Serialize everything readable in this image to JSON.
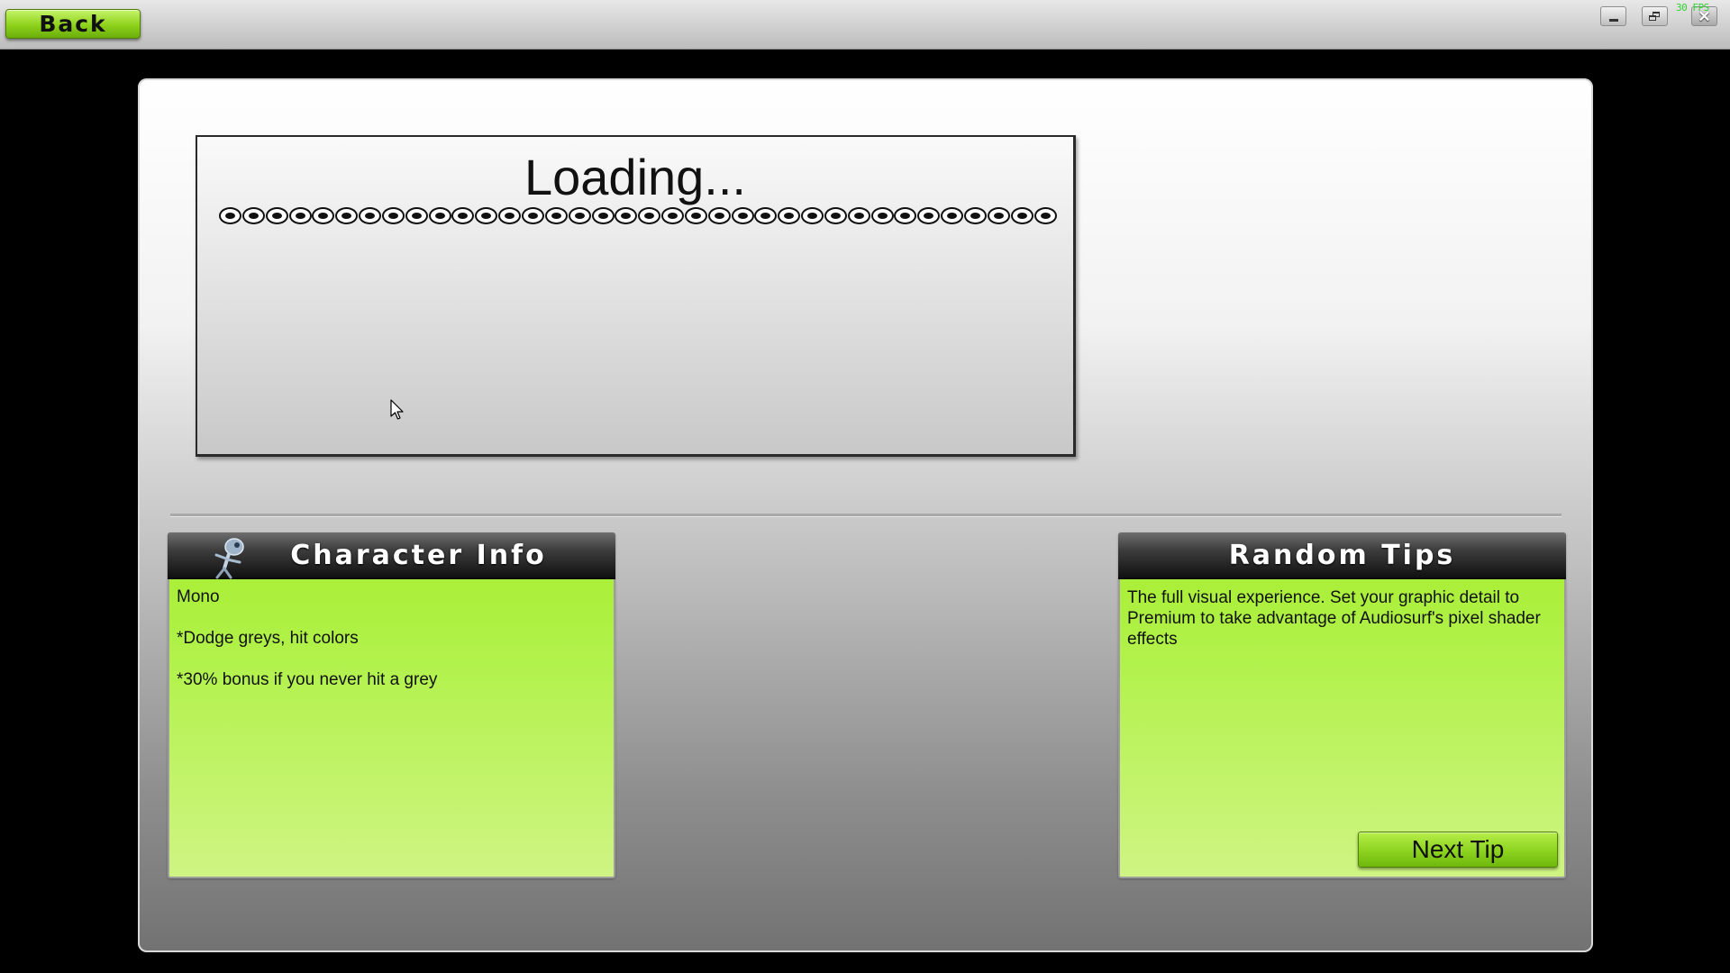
{
  "topbar": {
    "back_label": "Back",
    "fps_readout": "30 FPS"
  },
  "loading": {
    "text": "Loading...",
    "dot_count": 36
  },
  "character_info": {
    "title": "Character Info",
    "lines": [
      "Mono",
      "*Dodge greys, hit colors",
      "*30% bonus if you never hit a grey"
    ]
  },
  "random_tips": {
    "title": "Random Tips",
    "tip": "The full visual experience. Set your graphic detail to Premium to take advantage of Audiosurf's pixel shader effects",
    "next_label": "Next Tip"
  },
  "colors": {
    "accent_green": "#8ed21c",
    "panel_green": "#b3f24e",
    "header_dark": "#111111",
    "fps_green": "#35d035"
  }
}
